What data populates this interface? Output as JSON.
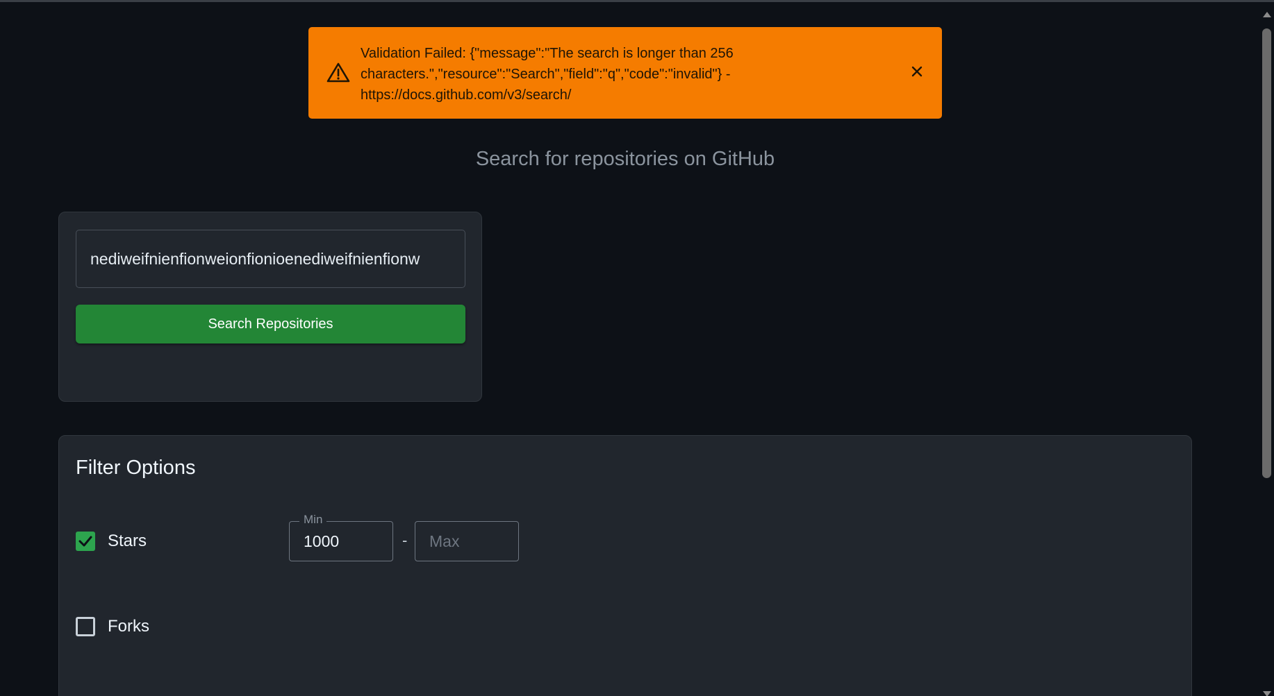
{
  "alert": {
    "message": "Validation Failed: {\"message\":\"The search is longer than 256 characters.\",\"resource\":\"Search\",\"field\":\"q\",\"code\":\"invalid\"} - https://docs.github.com/v3/search/",
    "icon": "warning-triangle-icon",
    "close_icon": "close-icon",
    "color": "#f57c00"
  },
  "header": {
    "subtitle": "Search for repositories on GitHub"
  },
  "search": {
    "query_value": "nediweifnienfionweionfionioenediweifnienfionw",
    "button_label": "Search Repositories",
    "button_color": "#238636"
  },
  "filters": {
    "title": "Filter Options",
    "stars": {
      "label": "Stars",
      "checked": true,
      "min_label": "Min",
      "min_value": "1000",
      "separator": "-",
      "max_placeholder": "Max"
    },
    "forks": {
      "label": "Forks",
      "checked": false
    }
  },
  "colors": {
    "background": "#0d1117",
    "card": "#21262d",
    "accent_green": "#2da44e"
  }
}
